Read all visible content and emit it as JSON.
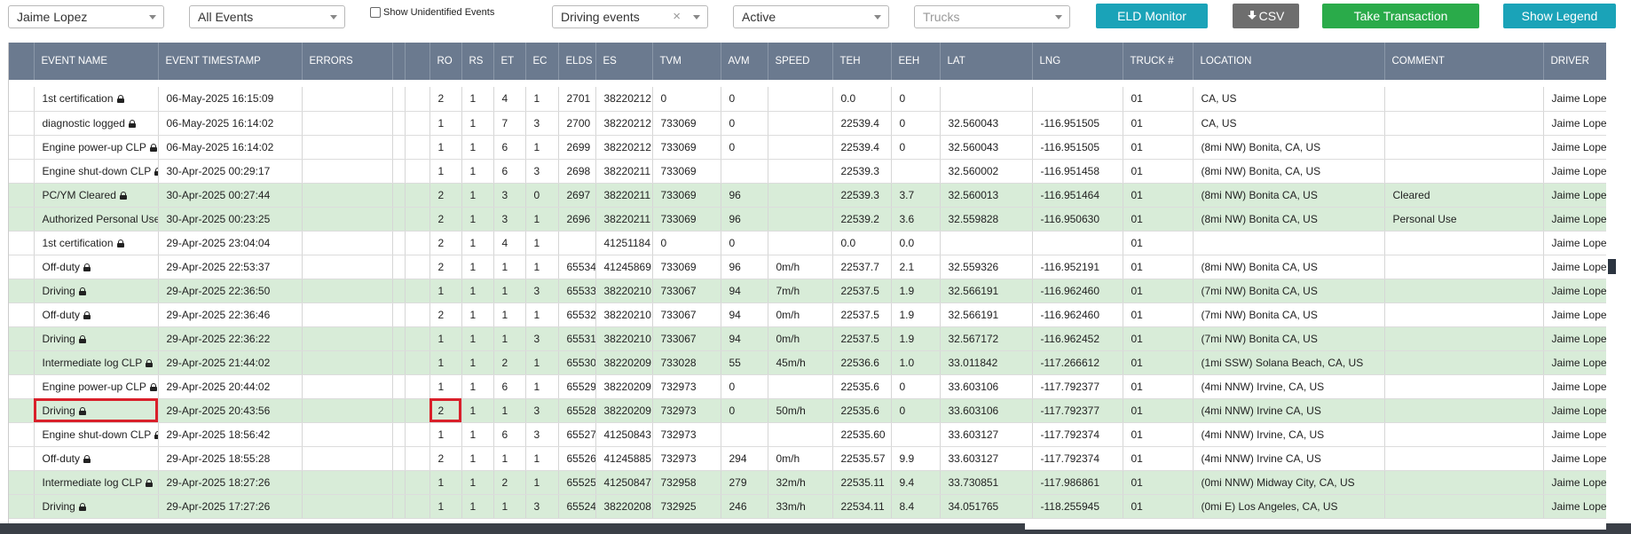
{
  "filters": {
    "driver": "Jaime Lopez",
    "events": "All Events",
    "show_unidentified_label": "Show Unidentified Events",
    "event_type": "Driving events",
    "clear_symbol": "×",
    "status": "Active",
    "trucks_placeholder": "Trucks"
  },
  "buttons": {
    "eld_monitor": "ELD Monitor",
    "csv": "CSV",
    "take_transaction": "Take Transaction",
    "show_legend": "Show Legend"
  },
  "colors": {
    "header_bg": "#6b7a8f",
    "row_green": "#d8ecd8",
    "highlight": "#d9202a",
    "btn_teal": "#1aa3b8",
    "btn_green": "#2aab4a",
    "btn_gray": "#6e6e6e"
  },
  "table": {
    "columns": [
      "",
      "EVENT NAME",
      "EVENT TIMESTAMP",
      "ERRORS",
      "",
      "",
      "RO",
      "RS",
      "ET",
      "EC",
      "ELDS",
      "ES",
      "TVM",
      "AVM",
      "SPEED",
      "TEH",
      "EEH",
      "LAT",
      "LNG",
      "TRUCK #",
      "LOCATION",
      "COMMENT",
      "DRIVER"
    ],
    "rows": [
      {
        "green": false,
        "name": "1st certification",
        "ts": "06-May-2025 16:15:09",
        "ro": "2",
        "rs": "1",
        "et": "4",
        "ec": "1",
        "elds": "2701",
        "es": "38220212",
        "tvm": "0",
        "avm": "0",
        "speed": "",
        "teh": "0.0",
        "eeh": "0",
        "lat": "",
        "lng": "",
        "truck": "01",
        "location": "CA, US",
        "comment": "",
        "driver": "Jaime Lopez"
      },
      {
        "green": false,
        "name": "diagnostic logged",
        "ts": "06-May-2025 16:14:02",
        "ro": "1",
        "rs": "1",
        "et": "7",
        "ec": "3",
        "elds": "2700",
        "es": "38220212",
        "tvm": "733069",
        "avm": "0",
        "speed": "",
        "teh": "22539.4",
        "eeh": "0",
        "lat": "32.560043",
        "lng": "-116.951505",
        "truck": "01",
        "location": "CA, US",
        "comment": "",
        "driver": "Jaime Lopez"
      },
      {
        "green": false,
        "name": "Engine power-up CLP",
        "ts": "06-May-2025 16:14:02",
        "ro": "1",
        "rs": "1",
        "et": "6",
        "ec": "1",
        "elds": "2699",
        "es": "38220212",
        "tvm": "733069",
        "avm": "0",
        "speed": "",
        "teh": "22539.4",
        "eeh": "0",
        "lat": "32.560043",
        "lng": "-116.951505",
        "truck": "01",
        "location": "(8mi NW) Bonita, CA, US",
        "comment": "",
        "driver": "Jaime Lopez"
      },
      {
        "green": false,
        "name": "Engine shut-down CLP",
        "ts": "30-Apr-2025 00:29:17",
        "ro": "1",
        "rs": "1",
        "et": "6",
        "ec": "3",
        "elds": "2698",
        "es": "38220211",
        "tvm": "733069",
        "avm": "",
        "speed": "",
        "teh": "22539.3",
        "eeh": "",
        "lat": "32.560002",
        "lng": "-116.951458",
        "truck": "01",
        "location": "(8mi NW) Bonita, CA, US",
        "comment": "",
        "driver": "Jaime Lopez"
      },
      {
        "green": true,
        "name": "PC/YM Cleared",
        "ts": "30-Apr-2025 00:27:44",
        "ro": "2",
        "rs": "1",
        "et": "3",
        "ec": "0",
        "elds": "2697",
        "es": "38220211",
        "tvm": "733069",
        "avm": "96",
        "speed": "",
        "teh": "22539.3",
        "eeh": "3.7",
        "lat": "32.560013",
        "lng": "-116.951464",
        "truck": "01",
        "location": "(8mi NW) Bonita CA, US",
        "comment": "Cleared",
        "driver": "Jaime Lopez"
      },
      {
        "green": true,
        "name": "Authorized Personal Use",
        "ts": "30-Apr-2025 00:23:25",
        "ro": "2",
        "rs": "1",
        "et": "3",
        "ec": "1",
        "elds": "2696",
        "es": "38220211",
        "tvm": "733069",
        "avm": "96",
        "speed": "",
        "teh": "22539.2",
        "eeh": "3.6",
        "lat": "32.559828",
        "lng": "-116.950630",
        "truck": "01",
        "location": "(8mi NW) Bonita CA, US",
        "comment": "Personal Use",
        "driver": "Jaime Lopez"
      },
      {
        "green": false,
        "name": "1st certification",
        "ts": "29-Apr-2025 23:04:04",
        "ro": "2",
        "rs": "1",
        "et": "4",
        "ec": "1",
        "elds": "",
        "es": "41251184",
        "tvm": "0",
        "avm": "0",
        "speed": "",
        "teh": "0.0",
        "eeh": "0.0",
        "lat": "",
        "lng": "",
        "truck": "01",
        "location": "",
        "comment": "",
        "driver": "Jaime Lopez"
      },
      {
        "green": false,
        "name": "Off-duty",
        "ts": "29-Apr-2025 22:53:37",
        "ro": "2",
        "rs": "1",
        "et": "1",
        "ec": "1",
        "elds": "65534",
        "es": "41245869",
        "tvm": "733069",
        "avm": "96",
        "speed": "0m/h",
        "teh": "22537.7",
        "eeh": "2.1",
        "lat": "32.559326",
        "lng": "-116.952191",
        "truck": "01",
        "location": "(8mi NW) Bonita CA, US",
        "comment": "",
        "driver": "Jaime Lopez"
      },
      {
        "green": true,
        "name": "Driving",
        "ts": "29-Apr-2025 22:36:50",
        "ro": "1",
        "rs": "1",
        "et": "1",
        "ec": "3",
        "elds": "65533",
        "es": "38220210",
        "tvm": "733067",
        "avm": "94",
        "speed": "7m/h",
        "teh": "22537.5",
        "eeh": "1.9",
        "lat": "32.566191",
        "lng": "-116.962460",
        "truck": "01",
        "location": "(7mi NW) Bonita CA, US",
        "comment": "",
        "driver": "Jaime Lopez"
      },
      {
        "green": false,
        "name": "Off-duty",
        "ts": "29-Apr-2025 22:36:46",
        "ro": "2",
        "rs": "1",
        "et": "1",
        "ec": "1",
        "elds": "65532",
        "es": "38220210",
        "tvm": "733067",
        "avm": "94",
        "speed": "0m/h",
        "teh": "22537.5",
        "eeh": "1.9",
        "lat": "32.566191",
        "lng": "-116.962460",
        "truck": "01",
        "location": "(7mi NW) Bonita CA, US",
        "comment": "",
        "driver": "Jaime Lopez"
      },
      {
        "green": true,
        "name": "Driving",
        "ts": "29-Apr-2025 22:36:22",
        "ro": "1",
        "rs": "1",
        "et": "1",
        "ec": "3",
        "elds": "65531",
        "es": "38220210",
        "tvm": "733067",
        "avm": "94",
        "speed": "0m/h",
        "teh": "22537.5",
        "eeh": "1.9",
        "lat": "32.567172",
        "lng": "-116.962452",
        "truck": "01",
        "location": "(7mi NW) Bonita CA, US",
        "comment": "",
        "driver": "Jaime Lopez"
      },
      {
        "green": true,
        "name": "Intermediate log CLP",
        "ts": "29-Apr-2025 21:44:02",
        "ro": "1",
        "rs": "1",
        "et": "2",
        "ec": "1",
        "elds": "65530",
        "es": "38220209",
        "tvm": "733028",
        "avm": "55",
        "speed": "45m/h",
        "teh": "22536.6",
        "eeh": "1.0",
        "lat": "33.011842",
        "lng": "-117.266612",
        "truck": "01",
        "location": "(1mi SSW) Solana Beach, CA, US",
        "comment": "",
        "driver": "Jaime Lopez"
      },
      {
        "green": false,
        "name": "Engine power-up CLP",
        "ts": "29-Apr-2025 20:44:02",
        "ro": "1",
        "rs": "1",
        "et": "6",
        "ec": "1",
        "elds": "65529",
        "es": "38220209",
        "tvm": "732973",
        "avm": "0",
        "speed": "",
        "teh": "22535.6",
        "eeh": "0",
        "lat": "33.603106",
        "lng": "-117.792377",
        "truck": "01",
        "location": "(4mi NNW) Irvine, CA, US",
        "comment": "",
        "driver": "Jaime Lopez"
      },
      {
        "green": true,
        "highlight": true,
        "name": "Driving",
        "ts": "29-Apr-2025 20:43:56",
        "ro": "2",
        "rs": "1",
        "et": "1",
        "ec": "3",
        "elds": "65528",
        "es": "38220209",
        "tvm": "732973",
        "avm": "0",
        "speed": "50m/h",
        "teh": "22535.6",
        "eeh": "0",
        "lat": "33.603106",
        "lng": "-117.792377",
        "truck": "01",
        "location": "(4mi NNW) Irvine CA, US",
        "comment": "",
        "driver": "Jaime Lopez"
      },
      {
        "green": false,
        "name": "Engine shut-down CLP",
        "ts": "29-Apr-2025 18:56:42",
        "ro": "1",
        "rs": "1",
        "et": "6",
        "ec": "3",
        "elds": "65527",
        "es": "41250843",
        "tvm": "732973",
        "avm": "",
        "speed": "",
        "teh": "22535.60",
        "eeh": "",
        "lat": "33.603127",
        "lng": "-117.792374",
        "truck": "01",
        "location": "(4mi NNW) Irvine, CA, US",
        "comment": "",
        "driver": "Jaime Lopez"
      },
      {
        "green": false,
        "name": "Off-duty",
        "ts": "29-Apr-2025 18:55:28",
        "ro": "2",
        "rs": "1",
        "et": "1",
        "ec": "1",
        "elds": "65526",
        "es": "41245885",
        "tvm": "732973",
        "avm": "294",
        "speed": "0m/h",
        "teh": "22535.57",
        "eeh": "9.9",
        "lat": "33.603127",
        "lng": "-117.792374",
        "truck": "01",
        "location": "(4mi NNW) Irvine CA, US",
        "comment": "",
        "driver": "Jaime Lopez"
      },
      {
        "green": true,
        "name": "Intermediate log CLP",
        "ts": "29-Apr-2025 18:27:26",
        "ro": "1",
        "rs": "1",
        "et": "2",
        "ec": "1",
        "elds": "65525",
        "es": "41250847",
        "tvm": "732958",
        "avm": "279",
        "speed": "32m/h",
        "teh": "22535.11",
        "eeh": "9.4",
        "lat": "33.730851",
        "lng": "-117.986861",
        "truck": "01",
        "location": "(0mi NNW) Midway City, CA, US",
        "comment": "",
        "driver": "Jaime Lopez"
      },
      {
        "green": true,
        "name": "Driving",
        "ts": "29-Apr-2025 17:27:26",
        "ro": "1",
        "rs": "1",
        "et": "1",
        "ec": "3",
        "elds": "65524",
        "es": "38220208",
        "tvm": "732925",
        "avm": "246",
        "speed": "33m/h",
        "teh": "22534.11",
        "eeh": "8.4",
        "lat": "34.051765",
        "lng": "-118.255945",
        "truck": "01",
        "location": "(0mi E) Los Angeles, CA, US",
        "comment": "",
        "driver": "Jaime Lopez"
      }
    ]
  }
}
